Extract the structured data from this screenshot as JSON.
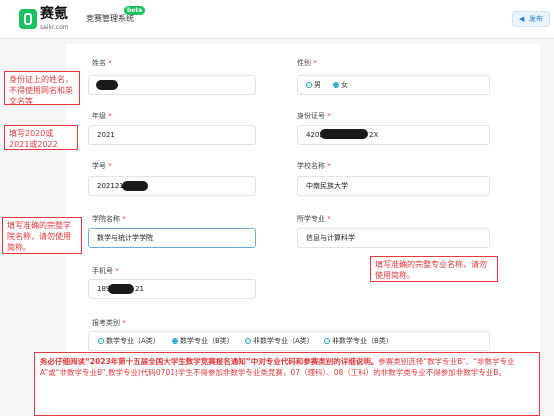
{
  "header": {
    "brand_cn": "赛氪",
    "brand_en": "saikr.com",
    "nav_title": "竞赛管理系统",
    "beta": "beta",
    "publish_label": "发布",
    "publish_icon": "send-icon"
  },
  "form": {
    "name": {
      "label": "姓名",
      "required": "*",
      "value": ""
    },
    "gender": {
      "label": "性别",
      "required": "*",
      "options": [
        "男",
        "女"
      ],
      "selected": "女"
    },
    "grade": {
      "label": "年级",
      "required": "*",
      "value": "2021"
    },
    "id_number": {
      "label": "身份证号",
      "required": "*",
      "prefix": "4202",
      "suffix": "2X"
    },
    "student_id": {
      "label": "学号",
      "required": "*",
      "value": "202121"
    },
    "school": {
      "label": "学校名称",
      "required": "*",
      "value": "中南民族大学"
    },
    "college": {
      "label": "学院名称",
      "required": "*",
      "value": "数学与统计学学院"
    },
    "major": {
      "label": "所学专业",
      "required": "*",
      "value": "信息与计算科学"
    },
    "phone": {
      "label": "手机号",
      "required": "*",
      "prefix": "189",
      "suffix": "21"
    },
    "category": {
      "label": "报考类别",
      "required": "*",
      "options": [
        "数学专业（A类）",
        "数学专业（B类）",
        "非数学专业（A类）",
        "非数学专业（B类）"
      ],
      "selected": "数学专业（B类）"
    }
  },
  "notes": {
    "name_note": "身份证上的姓名，不得使用网名和英文名等",
    "grade_note": "填写2020或2021或2022",
    "college_note": "填写准确的完整学院名称，请勿使用简称。",
    "major_note": "填写准确的完整专业名称，请勿使用简称。",
    "bottom_prefix": "务必仔细阅读",
    "bottom_title": "“2023年第十五届全国大学生数学竞赛报名通知”",
    "bottom_mid": "中对专业代码和参赛类别的详细说明。",
    "bottom_rest": "参赛类别选择“数学专业B”、“非数学专业A”或“非数学专业B”,数学专业(代码0701)学生不得参加非数学专业类竞赛，07（理科）、08（工科）的非数学类专业不得参加非数学专业B。"
  },
  "colors": {
    "brand": "#18c25e",
    "required": "#e4393c",
    "radio": "#1aa3c7",
    "note": "#e4393c"
  }
}
